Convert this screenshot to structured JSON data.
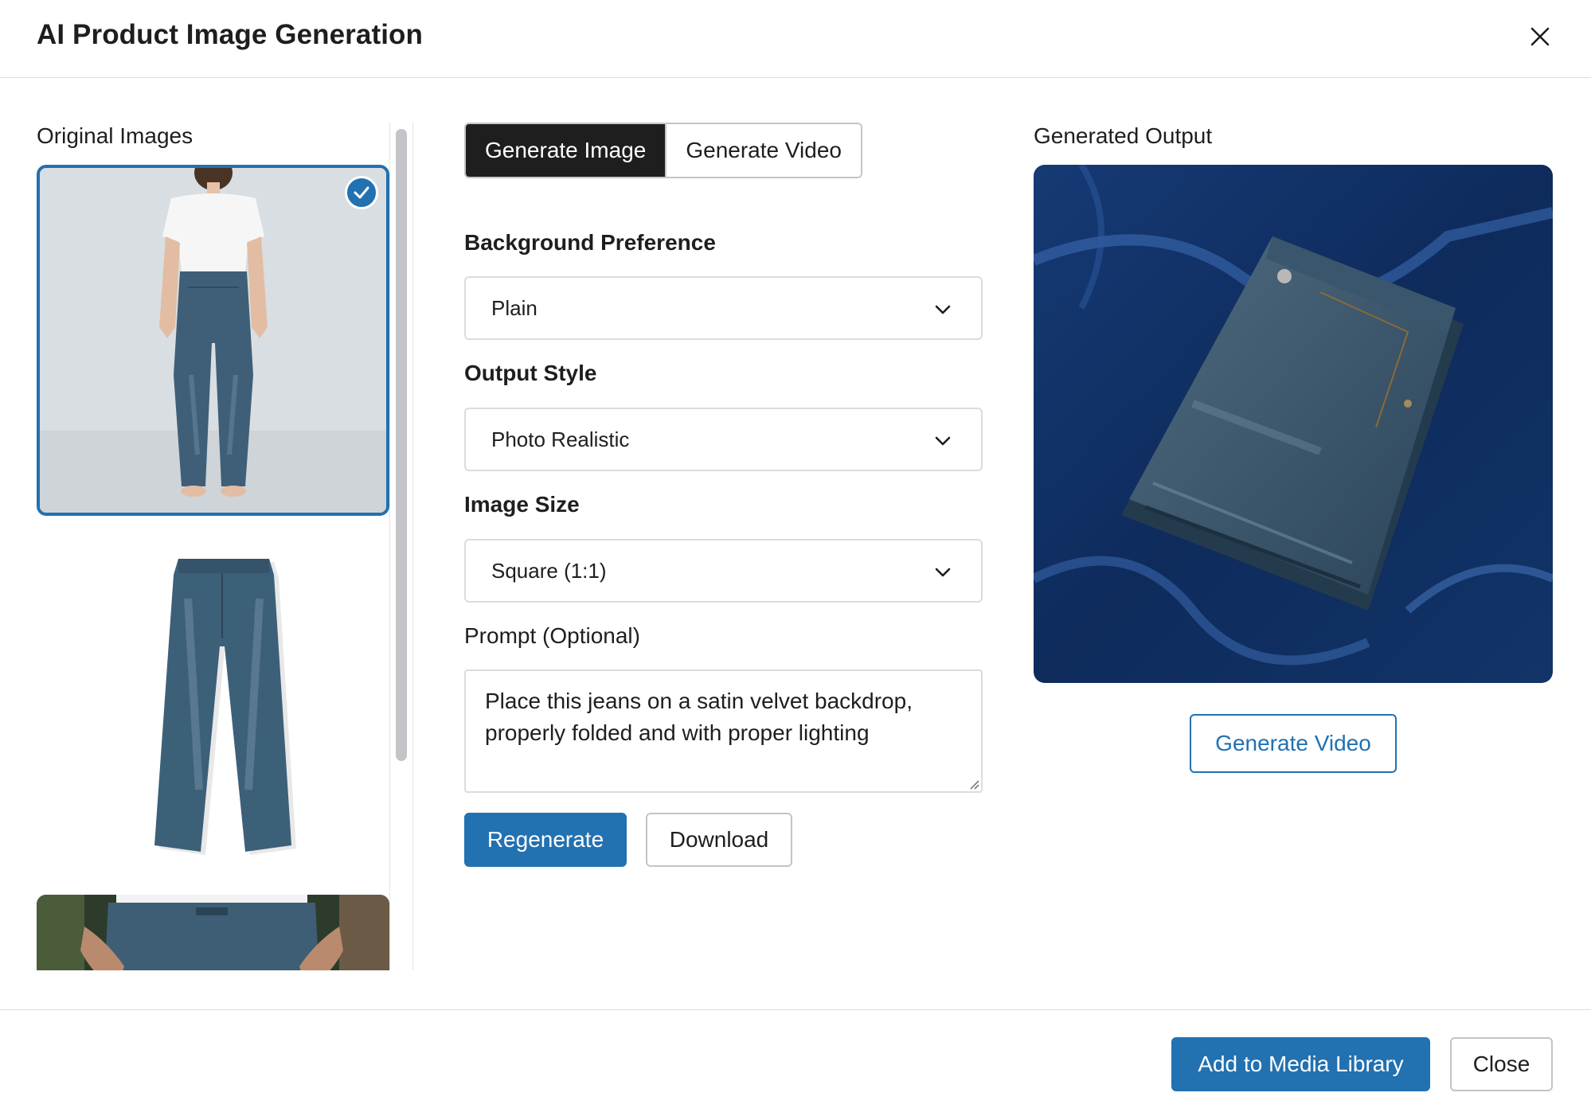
{
  "modal": {
    "title": "AI Product Image Generation",
    "close_icon": "close-icon"
  },
  "original_images": {
    "label": "Original Images",
    "items": [
      {
        "name": "model-wearing-jeans",
        "selected": true
      },
      {
        "name": "jeans-flat",
        "selected": false
      },
      {
        "name": "jeans-closeup",
        "selected": false
      }
    ]
  },
  "tabs": [
    {
      "label": "Generate Image",
      "active": true
    },
    {
      "label": "Generate Video",
      "active": false
    }
  ],
  "form": {
    "background": {
      "label": "Background Preference",
      "value": "Plain"
    },
    "style": {
      "label": "Output Style",
      "value": "Photo Realistic"
    },
    "size": {
      "label": "Image Size",
      "value": "Square (1:1)"
    },
    "prompt": {
      "label": "Prompt (Optional)",
      "value": "Place this jeans on a satin velvet backdrop, properly folded and with proper lighting"
    },
    "regenerate_label": "Regenerate",
    "download_label": "Download"
  },
  "output": {
    "label": "Generated Output",
    "generate_video_label": "Generate Video"
  },
  "footer": {
    "add_label": "Add to Media Library",
    "close_label": "Close"
  },
  "colors": {
    "primary": "#2271b1",
    "dark": "#1e1e1e",
    "border": "#dcdcde"
  }
}
